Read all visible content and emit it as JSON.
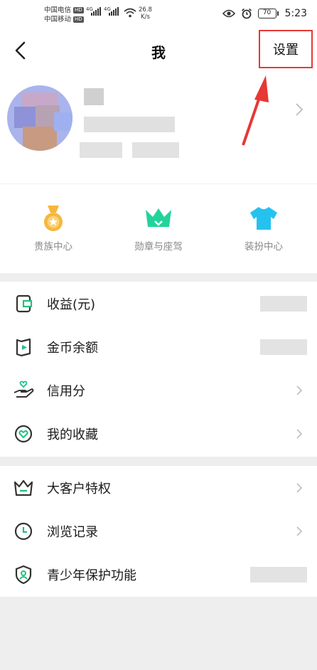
{
  "status_bar": {
    "carrier1": "中国电信",
    "carrier2": "中国移动",
    "hd_tag": "HD",
    "net_tag": "4G",
    "speed_value": "26.8",
    "speed_unit": "K/s",
    "battery": "70",
    "time": "5:23"
  },
  "header": {
    "title": "我",
    "settings_label": "设置"
  },
  "quick_actions": [
    {
      "label": "贵族中心",
      "icon": "medal-icon",
      "color": "#f6b73c"
    },
    {
      "label": "勋章与座驾",
      "icon": "crown-icon",
      "color": "#22d39b"
    },
    {
      "label": "装扮中心",
      "icon": "tshirt-icon",
      "color": "#25c2f0"
    }
  ],
  "menu_group_1": [
    {
      "label": "收益(元)",
      "icon": "wallet-icon"
    },
    {
      "label": "金币余额",
      "icon": "coin-book-icon"
    },
    {
      "label": "信用分",
      "icon": "credit-hand-icon"
    },
    {
      "label": "我的收藏",
      "icon": "favorite-icon"
    }
  ],
  "menu_group_2": [
    {
      "label": "大客户特权",
      "icon": "crown-outline-icon"
    },
    {
      "label": "浏览记录",
      "icon": "clock-icon"
    },
    {
      "label": "青少年保护功能",
      "icon": "shield-user-icon"
    }
  ],
  "colors": {
    "accent": "#21c17f",
    "annotation": "#e53935"
  }
}
